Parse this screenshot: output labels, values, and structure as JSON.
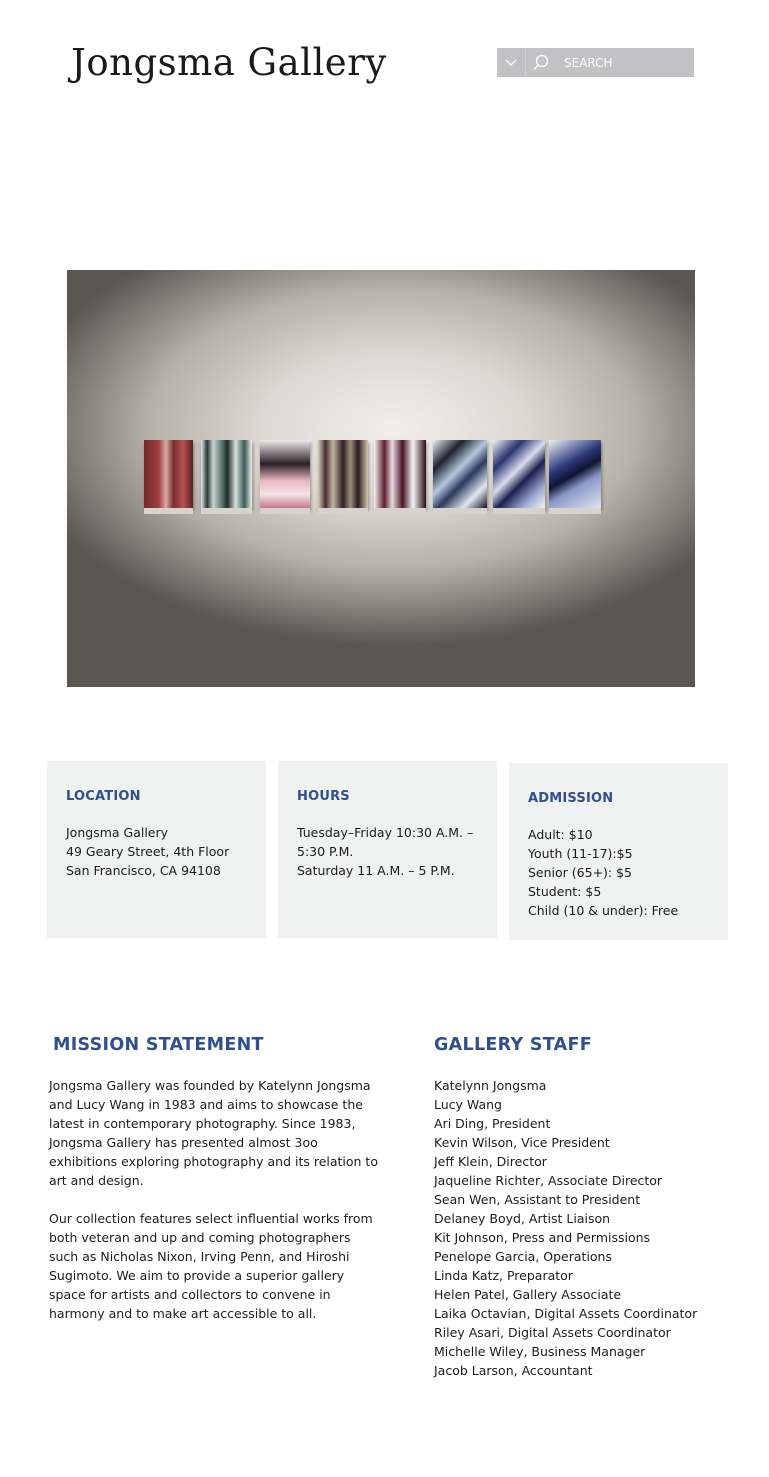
{
  "header": {
    "logo": "Jongsma Gallery",
    "search_placeholder": "SEARCH",
    "icons": [
      "chevron-down-icon",
      "search-icon"
    ]
  },
  "info": {
    "location": {
      "title": "LOCATION",
      "lines": [
        "Jongsma Gallery",
        "49 Geary Street, 4th Floor",
        "San Francisco, CA 94108"
      ]
    },
    "hours": {
      "title": "HOURS",
      "lines": [
        "Tuesday–Friday  10:30 A.M. –",
        "5:30 P.M.",
        "Saturday  11 A.M. – 5 P.M."
      ]
    },
    "admission": {
      "title": "ADMISSION",
      "lines": [
        "Adult: $10",
        "Youth (11-17):$5",
        "Senior (65+): $5",
        "Student: $5",
        "Child (10 & under): Free"
      ]
    }
  },
  "mission": {
    "title": "MISSION STATEMENT",
    "paragraph1_lines": [
      "Jongsma Gallery was founded by Katelynn Jongsma",
      "and Lucy Wang in 1983 and aims to showcase the",
      "latest in contemporary photography. Since 1983,",
      "Jongsma Gallery has presented almost 3oo",
      "exhibitions exploring photography and its relation to",
      "art and design."
    ],
    "paragraph2_lines": [
      "Our collection features select influential works from",
      "both veteran and up and coming photographers",
      "such as Nicholas Nixon, Irving Penn, and Hiroshi",
      "Sugimoto. We aim to provide a superior gallery",
      "space for artists and collectors to convene in",
      "harmony and to make art accessible to all."
    ]
  },
  "staff": {
    "title": "GALLERY STAFF",
    "members": [
      "Katelynn Jongsma",
      "Lucy Wang",
      "Ari Ding, President",
      "Kevin Wilson, Vice President",
      "Jeff Klein, Director",
      "Jaqueline Richter, Associate Director",
      "Sean Wen, Assistant to President",
      "Delaney Boyd, Artist Liaison",
      "Kit Johnson, Press and Permissions",
      "Penelope Garcia, Operations",
      "Linda Katz, Preparator",
      "Helen Patel, Gallery Associate",
      "Laika Octavian, Digital Assets Coordinator",
      "Riley Asari, Digital Assets Coordinator",
      "Michelle Wiley, Business Manager",
      "Jacob Larson, Accountant"
    ]
  },
  "colors": {
    "accent": "#2f4f8f",
    "card_bg": "#f0f1f1",
    "search_bg": "#c2c2c4"
  }
}
